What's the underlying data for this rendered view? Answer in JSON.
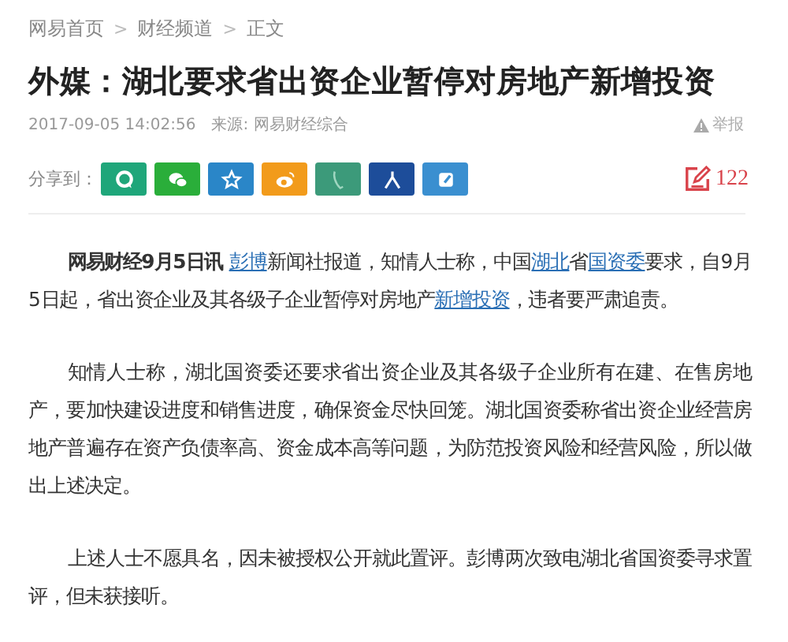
{
  "breadcrumb": {
    "items": [
      "网易首页",
      "财经频道",
      "正文"
    ],
    "separator": ">"
  },
  "title": "外媒：湖北要求省出资企业暂停对房地产新增投资",
  "meta": {
    "time": "2017-09-05 14:02:56",
    "source": "来源: 网易财经综合",
    "report": "举报"
  },
  "share": {
    "label": "分享到：",
    "buttons": [
      {
        "kind": "bubble",
        "color": "#1fa67a"
      },
      {
        "kind": "chat",
        "color": "#2aae3a"
      },
      {
        "kind": "star",
        "color": "#2a86c8"
      },
      {
        "kind": "eye",
        "color": "#f29b1b"
      },
      {
        "kind": "phone",
        "color": "#3c9a7a"
      },
      {
        "kind": "person",
        "color": "#1d4d9a"
      },
      {
        "kind": "square",
        "color": "#3a8fd0"
      }
    ]
  },
  "comments": {
    "count": "122"
  },
  "paragraphs": [
    [
      {
        "kind": "lead",
        "text": "网易财经9月5日讯"
      },
      {
        "kind": "link",
        "text": "彭博"
      },
      {
        "kind": "text",
        "text": "新闻社报道，知情人士称，中国"
      },
      {
        "kind": "link",
        "text": "湖北"
      },
      {
        "kind": "text",
        "text": "省"
      },
      {
        "kind": "link",
        "text": "国资委"
      },
      {
        "kind": "text",
        "text": "要求，自9月5日起，省出资企业及其各级子企业暂停对房地产"
      },
      {
        "kind": "link",
        "text": "新增投资"
      },
      {
        "kind": "text",
        "text": "，违者要严肃追责。"
      }
    ],
    [
      {
        "kind": "text",
        "text": "知情人士称，湖北国资委还要求省出资企业及其各级子企业所有在建、在售房地产，要加快建设进度和销售进度，确保资金尽快回笼。湖北国资委称省出资企业经营房地产普遍存在资产负债率高、资金成本高等问题，为防范投资风险和经营风险，所以做出上述决定。"
      }
    ],
    [
      {
        "kind": "text",
        "text": "上述人士不愿具名，因未被授权公开就此置评。彭博两次致电湖北省国资委寻求置评，但未获接听。"
      }
    ]
  ]
}
